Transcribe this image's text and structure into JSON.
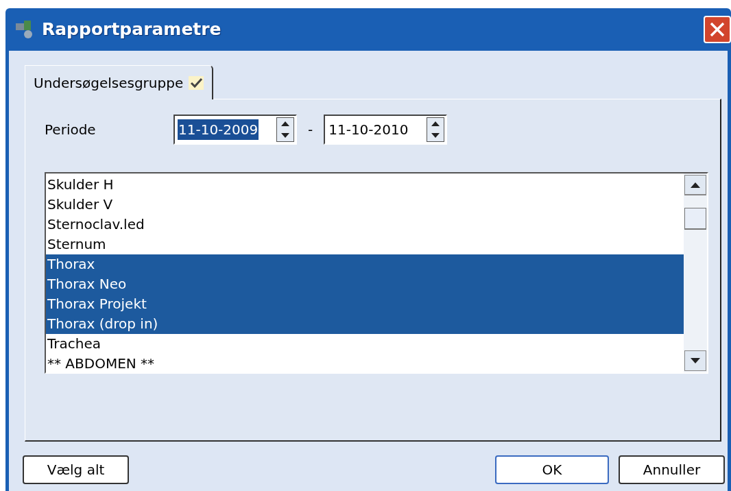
{
  "window": {
    "title": "Rapportparametre"
  },
  "tabs": [
    {
      "label": "Undersøgelsesgruppe",
      "selected": true,
      "checked": true
    }
  ],
  "period": {
    "label": "Periode",
    "separator": "-",
    "from": {
      "value": "11-10-2009",
      "highlighted": true
    },
    "to": {
      "value": "11-10-2010",
      "highlighted": false
    }
  },
  "list": {
    "items": [
      {
        "label": "Skulder H",
        "selected": false
      },
      {
        "label": "Skulder V",
        "selected": false
      },
      {
        "label": "Sternoclav.led",
        "selected": false
      },
      {
        "label": "Sternum",
        "selected": false
      },
      {
        "label": "Thorax",
        "selected": true
      },
      {
        "label": "Thorax Neo",
        "selected": true
      },
      {
        "label": "Thorax Projekt",
        "selected": true
      },
      {
        "label": "Thorax (drop in)",
        "selected": true
      },
      {
        "label": "Trachea",
        "selected": false
      },
      {
        "label": "** ABDOMEN **",
        "selected": false
      }
    ]
  },
  "buttons": [
    {
      "label": "Vælg alt",
      "kind": "left"
    },
    {
      "label": "OK",
      "kind": "default"
    },
    {
      "label": "Annuller",
      "kind": "normal"
    }
  ]
}
